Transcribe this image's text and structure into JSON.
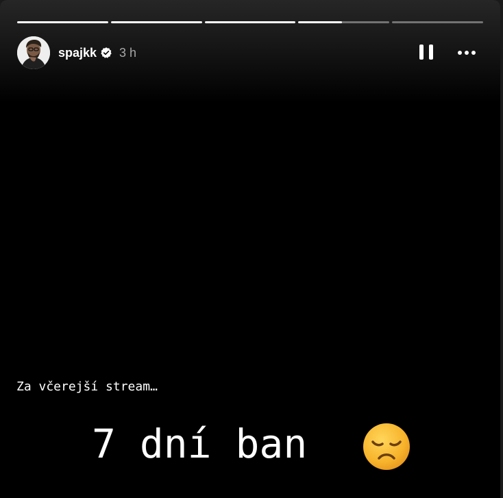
{
  "story": {
    "progress": [
      1.0,
      1.0,
      1.0,
      0.48,
      0.0
    ],
    "user": {
      "username": "spajkk",
      "verified": true,
      "avatar_icon": "avatar-image",
      "verified_icon": "verified-badge-icon"
    },
    "time": "3 h",
    "controls": {
      "pause_icon": "pause-icon",
      "more_icon": "more-options-icon"
    },
    "caption": "Za včerejší stream…",
    "headline": "7 dní ban",
    "emoji_icon": "disappointed-face-emoji",
    "colors": {
      "background": "#000000",
      "text": "#ffffff",
      "muted": "#a8a8a8",
      "verified": "#ffffff",
      "emoji": "#f6b93b"
    }
  }
}
